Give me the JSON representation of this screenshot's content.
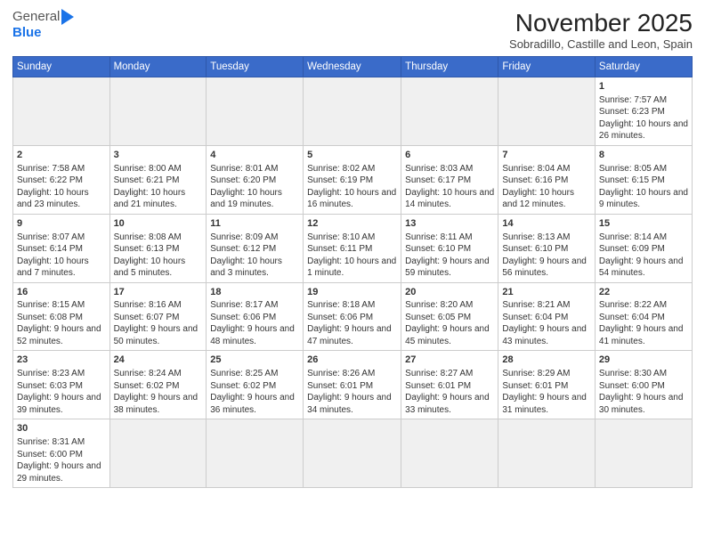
{
  "header": {
    "logo_line1": "General",
    "logo_line2": "Blue",
    "title": "November 2025",
    "subtitle": "Sobradillo, Castille and Leon, Spain"
  },
  "days_of_week": [
    "Sunday",
    "Monday",
    "Tuesday",
    "Wednesday",
    "Thursday",
    "Friday",
    "Saturday"
  ],
  "weeks": [
    [
      {
        "num": "",
        "info": "",
        "empty": true
      },
      {
        "num": "",
        "info": "",
        "empty": true
      },
      {
        "num": "",
        "info": "",
        "empty": true
      },
      {
        "num": "",
        "info": "",
        "empty": true
      },
      {
        "num": "",
        "info": "",
        "empty": true
      },
      {
        "num": "",
        "info": "",
        "empty": true
      },
      {
        "num": "1",
        "info": "Sunrise: 7:57 AM\nSunset: 6:23 PM\nDaylight: 10 hours and 26 minutes.",
        "empty": false
      }
    ],
    [
      {
        "num": "2",
        "info": "Sunrise: 7:58 AM\nSunset: 6:22 PM\nDaylight: 10 hours and 23 minutes.",
        "empty": false
      },
      {
        "num": "3",
        "info": "Sunrise: 8:00 AM\nSunset: 6:21 PM\nDaylight: 10 hours and 21 minutes.",
        "empty": false
      },
      {
        "num": "4",
        "info": "Sunrise: 8:01 AM\nSunset: 6:20 PM\nDaylight: 10 hours and 19 minutes.",
        "empty": false
      },
      {
        "num": "5",
        "info": "Sunrise: 8:02 AM\nSunset: 6:19 PM\nDaylight: 10 hours and 16 minutes.",
        "empty": false
      },
      {
        "num": "6",
        "info": "Sunrise: 8:03 AM\nSunset: 6:17 PM\nDaylight: 10 hours and 14 minutes.",
        "empty": false
      },
      {
        "num": "7",
        "info": "Sunrise: 8:04 AM\nSunset: 6:16 PM\nDaylight: 10 hours and 12 minutes.",
        "empty": false
      },
      {
        "num": "8",
        "info": "Sunrise: 8:05 AM\nSunset: 6:15 PM\nDaylight: 10 hours and 9 minutes.",
        "empty": false
      }
    ],
    [
      {
        "num": "9",
        "info": "Sunrise: 8:07 AM\nSunset: 6:14 PM\nDaylight: 10 hours and 7 minutes.",
        "empty": false
      },
      {
        "num": "10",
        "info": "Sunrise: 8:08 AM\nSunset: 6:13 PM\nDaylight: 10 hours and 5 minutes.",
        "empty": false
      },
      {
        "num": "11",
        "info": "Sunrise: 8:09 AM\nSunset: 6:12 PM\nDaylight: 10 hours and 3 minutes.",
        "empty": false
      },
      {
        "num": "12",
        "info": "Sunrise: 8:10 AM\nSunset: 6:11 PM\nDaylight: 10 hours and 1 minute.",
        "empty": false
      },
      {
        "num": "13",
        "info": "Sunrise: 8:11 AM\nSunset: 6:10 PM\nDaylight: 9 hours and 59 minutes.",
        "empty": false
      },
      {
        "num": "14",
        "info": "Sunrise: 8:13 AM\nSunset: 6:10 PM\nDaylight: 9 hours and 56 minutes.",
        "empty": false
      },
      {
        "num": "15",
        "info": "Sunrise: 8:14 AM\nSunset: 6:09 PM\nDaylight: 9 hours and 54 minutes.",
        "empty": false
      }
    ],
    [
      {
        "num": "16",
        "info": "Sunrise: 8:15 AM\nSunset: 6:08 PM\nDaylight: 9 hours and 52 minutes.",
        "empty": false
      },
      {
        "num": "17",
        "info": "Sunrise: 8:16 AM\nSunset: 6:07 PM\nDaylight: 9 hours and 50 minutes.",
        "empty": false
      },
      {
        "num": "18",
        "info": "Sunrise: 8:17 AM\nSunset: 6:06 PM\nDaylight: 9 hours and 48 minutes.",
        "empty": false
      },
      {
        "num": "19",
        "info": "Sunrise: 8:18 AM\nSunset: 6:06 PM\nDaylight: 9 hours and 47 minutes.",
        "empty": false
      },
      {
        "num": "20",
        "info": "Sunrise: 8:20 AM\nSunset: 6:05 PM\nDaylight: 9 hours and 45 minutes.",
        "empty": false
      },
      {
        "num": "21",
        "info": "Sunrise: 8:21 AM\nSunset: 6:04 PM\nDaylight: 9 hours and 43 minutes.",
        "empty": false
      },
      {
        "num": "22",
        "info": "Sunrise: 8:22 AM\nSunset: 6:04 PM\nDaylight: 9 hours and 41 minutes.",
        "empty": false
      }
    ],
    [
      {
        "num": "23",
        "info": "Sunrise: 8:23 AM\nSunset: 6:03 PM\nDaylight: 9 hours and 39 minutes.",
        "empty": false
      },
      {
        "num": "24",
        "info": "Sunrise: 8:24 AM\nSunset: 6:02 PM\nDaylight: 9 hours and 38 minutes.",
        "empty": false
      },
      {
        "num": "25",
        "info": "Sunrise: 8:25 AM\nSunset: 6:02 PM\nDaylight: 9 hours and 36 minutes.",
        "empty": false
      },
      {
        "num": "26",
        "info": "Sunrise: 8:26 AM\nSunset: 6:01 PM\nDaylight: 9 hours and 34 minutes.",
        "empty": false
      },
      {
        "num": "27",
        "info": "Sunrise: 8:27 AM\nSunset: 6:01 PM\nDaylight: 9 hours and 33 minutes.",
        "empty": false
      },
      {
        "num": "28",
        "info": "Sunrise: 8:29 AM\nSunset: 6:01 PM\nDaylight: 9 hours and 31 minutes.",
        "empty": false
      },
      {
        "num": "29",
        "info": "Sunrise: 8:30 AM\nSunset: 6:00 PM\nDaylight: 9 hours and 30 minutes.",
        "empty": false
      }
    ],
    [
      {
        "num": "30",
        "info": "Sunrise: 8:31 AM\nSunset: 6:00 PM\nDaylight: 9 hours and 29 minutes.",
        "empty": false
      },
      {
        "num": "",
        "info": "",
        "empty": true
      },
      {
        "num": "",
        "info": "",
        "empty": true
      },
      {
        "num": "",
        "info": "",
        "empty": true
      },
      {
        "num": "",
        "info": "",
        "empty": true
      },
      {
        "num": "",
        "info": "",
        "empty": true
      },
      {
        "num": "",
        "info": "",
        "empty": true
      }
    ]
  ]
}
